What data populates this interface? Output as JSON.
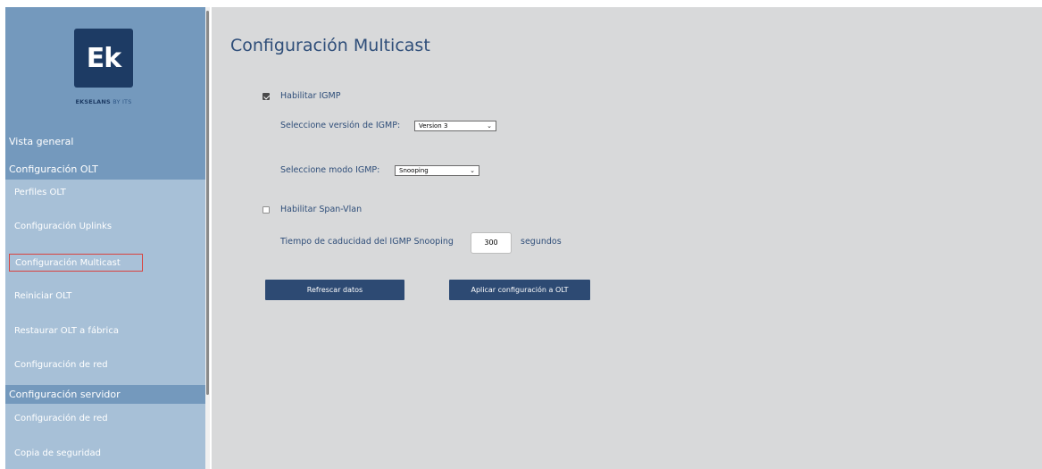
{
  "brand": {
    "logo_text": "Ek",
    "logo_sub_main": "EKSELANS",
    "logo_sub_by": " BY ITS"
  },
  "sidebar": {
    "vista_general": "Vista general",
    "section_olt": "Configuración OLT",
    "olt_items": [
      {
        "label": "Perfiles OLT"
      },
      {
        "label": "Configuración Uplinks"
      },
      {
        "label": "Configuración Multicast"
      },
      {
        "label": "Reiniciar OLT"
      },
      {
        "label": "Restaurar OLT a fábrica"
      },
      {
        "label": "Configuración de red"
      }
    ],
    "section_servidor": "Configuración servidor",
    "servidor_items": [
      {
        "label": "Configuración de red"
      },
      {
        "label": "Copia de seguridad"
      }
    ],
    "active_item": "Configuración Multicast"
  },
  "main": {
    "title": "Configuración Multicast",
    "igmp_enable_label": "Habilitar IGMP",
    "igmp_enabled": true,
    "igmp_version_label": "Seleccione versión de IGMP:",
    "igmp_version_value": "Version 3",
    "igmp_mode_label": "Seleccione modo IGMP:",
    "igmp_mode_value": "Snooping",
    "span_vlan_label": "Habilitar Span-Vlan",
    "span_vlan_enabled": false,
    "timeout_label": "Tiempo de caducidad del IGMP Snooping",
    "timeout_value": "300",
    "timeout_unit": "segundos",
    "refresh_button": "Refrescar datos",
    "apply_button": "Aplicar configuración a OLT"
  },
  "colors": {
    "sidebar_dark": "#7499bd",
    "sidebar_light": "#a7c0d7",
    "brand_navy": "#1d3b64",
    "main_bg": "#d8d9da",
    "title_color": "#2f4e79",
    "button_bg": "#2d4a73",
    "active_border": "#d9433f"
  }
}
